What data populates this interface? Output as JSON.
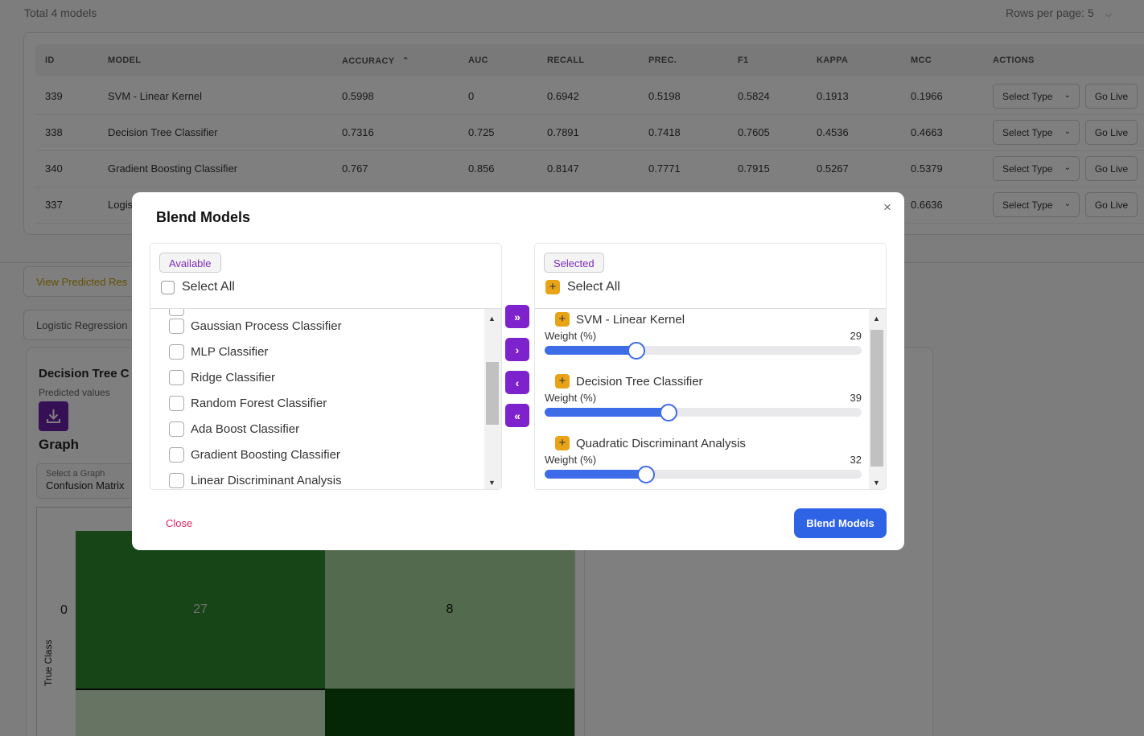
{
  "page": {
    "total_label": "Total 4 models",
    "rows_per_page_label": "Rows per page: 5"
  },
  "table": {
    "headers": [
      "ID",
      "MODEL",
      "ACCURACY",
      "AUC",
      "RECALL",
      "PREC.",
      "F1",
      "KAPPA",
      "MCC",
      "ACTIONS"
    ],
    "sort_indicator": "⌃",
    "rows": [
      {
        "id": "339",
        "model": "SVM - Linear Kernel",
        "accuracy": "0.5998",
        "auc": "0",
        "recall": "0.6942",
        "prec": "0.5198",
        "f1": "0.5824",
        "kappa": "0.1913",
        "mcc": "0.1966"
      },
      {
        "id": "338",
        "model": "Decision Tree Classifier",
        "accuracy": "0.7316",
        "auc": "0.725",
        "recall": "0.7891",
        "prec": "0.7418",
        "f1": "0.7605",
        "kappa": "0.4536",
        "mcc": "0.4663"
      },
      {
        "id": "340",
        "model": "Gradient Boosting Classifier",
        "accuracy": "0.767",
        "auc": "0.856",
        "recall": "0.8147",
        "prec": "0.7771",
        "f1": "0.7915",
        "kappa": "0.5267",
        "mcc": "0.5379"
      },
      {
        "id": "337",
        "model": "Logis",
        "accuracy": "",
        "auc": "",
        "recall": "",
        "prec": "",
        "f1": "",
        "kappa": "",
        "mcc": "0.6636"
      }
    ],
    "select_type_label": "Select Type",
    "go_live_label": "Go Live"
  },
  "background": {
    "view_predicted_label": "View Predicted Res",
    "model_select_value": "Logistic Regression",
    "card_title": "Decision Tree C",
    "card_subtitle": "Predicted values",
    "graph_heading": "Graph",
    "graph_select_label": "Select a Graph",
    "graph_select_value": "Confusion Matrix",
    "confusion": {
      "y_tick_0": "0",
      "y_axis_label": "True Class",
      "cells": [
        "27",
        "8",
        "",
        ""
      ],
      "colors": [
        "#2e8b2e",
        "#a6d49c",
        "#cfe8c9",
        "#0a4f0a"
      ]
    }
  },
  "modal": {
    "title": "Blend Models",
    "close_x": "×",
    "available": {
      "chip_label": "Available",
      "select_all_label": "Select All",
      "items": [
        "Gaussian Process Classifier",
        "MLP Classifier",
        "Ridge Classifier",
        "Random Forest Classifier",
        "Ada Boost Classifier",
        "Gradient Boosting Classifier",
        "Linear Discriminant Analysis"
      ]
    },
    "selected": {
      "chip_label": "Selected",
      "select_all_label": "Select All",
      "plus_glyph": "+",
      "weight_label": "Weight (%)",
      "items": [
        {
          "name": "SVM - Linear Kernel",
          "weight": 29,
          "weight_display": "29"
        },
        {
          "name": "Decision Tree Classifier",
          "weight": 39,
          "weight_display": "39"
        },
        {
          "name": "Quadratic Discriminant Analysis",
          "weight": 32,
          "weight_display": "32"
        }
      ],
      "slider_max": 100,
      "slider_color": "#3d6ce8"
    },
    "transfer_buttons": [
      "»",
      "›",
      "‹",
      "«"
    ],
    "close_label": "Close",
    "blend_label": "Blend Models",
    "accent_purple": "#7e22ce",
    "accent_blue": "#2f63e6"
  }
}
